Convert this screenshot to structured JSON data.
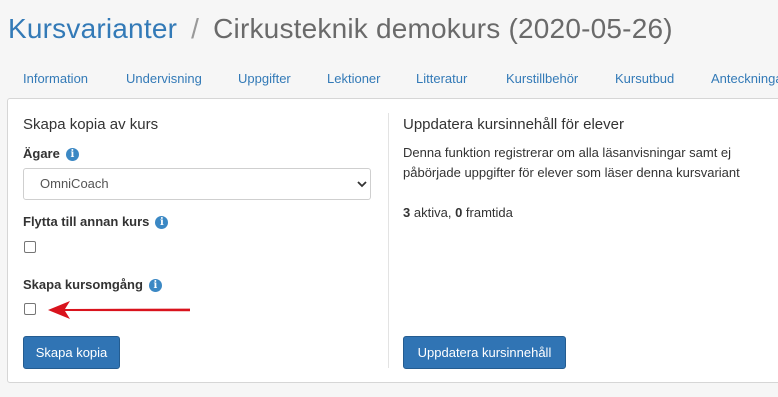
{
  "breadcrumb": {
    "parent": "Kursvarianter",
    "separator": "/",
    "current": "Cirkusteknik demokurs (2020-05-26)"
  },
  "tabs": [
    "Information",
    "Undervisning",
    "Uppgifter",
    "Lektioner",
    "Litteratur",
    "Kurstillbehör",
    "Kursutbud",
    "Anteckninga"
  ],
  "copy_section": {
    "title": "Skapa kopia av kurs",
    "owner_label": "Ägare",
    "owner_value": "OmniCoach",
    "move_label": "Flytta till annan kurs",
    "move_checked": false,
    "create_label": "Skapa kursomgång",
    "create_checked": false,
    "button": "Skapa kopia"
  },
  "update_section": {
    "title": "Uppdatera kursinnehåll för elever",
    "description": "Denna funktion registrerar om alla läsanvisningar samt ej påbörjade uppgifter för elever som läser denna kursvariant",
    "active_count": "3",
    "active_label": "aktiva,",
    "future_count": "0",
    "future_label": "framtida",
    "button": "Uppdatera kursinnehåll"
  },
  "icons": {
    "info": "info-icon",
    "arrow": "red-arrow-annotation"
  },
  "colors": {
    "link": "#337ab7",
    "button": "#3074b4",
    "arrow": "#d9131d"
  }
}
